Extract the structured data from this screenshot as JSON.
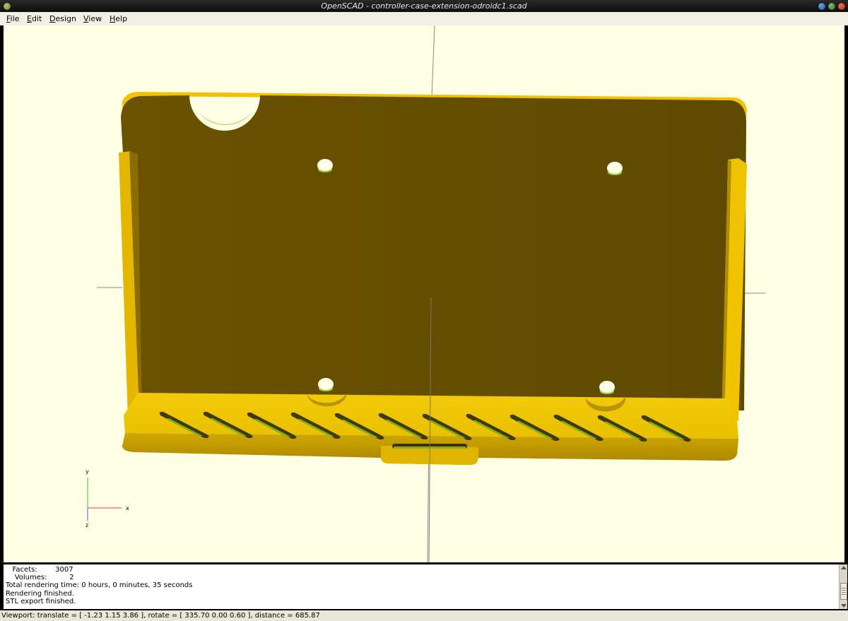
{
  "window": {
    "title": "OpenSCAD - controller-case-extension-odroidc1.scad"
  },
  "menu": {
    "items": [
      "File",
      "Edit",
      "Design",
      "View",
      "Help"
    ]
  },
  "viewport": {
    "background": "#ffffe5",
    "model_color": "#f2c200",
    "axes": {
      "x": "x",
      "y": "y",
      "z": "z"
    }
  },
  "console": {
    "facets_label": "Facets:",
    "facets_value": "3007",
    "volumes_label": "Volumes:",
    "volumes_value": "2",
    "lines": [
      "Total rendering time: 0 hours, 0 minutes, 35 seconds",
      "Rendering finished.",
      "STL export finished."
    ]
  },
  "status": {
    "text": "Viewport: translate = [ -1.23 1.15 3.86 ], rotate = [ 335.70 0.00 0.60 ], distance = 685.87"
  }
}
